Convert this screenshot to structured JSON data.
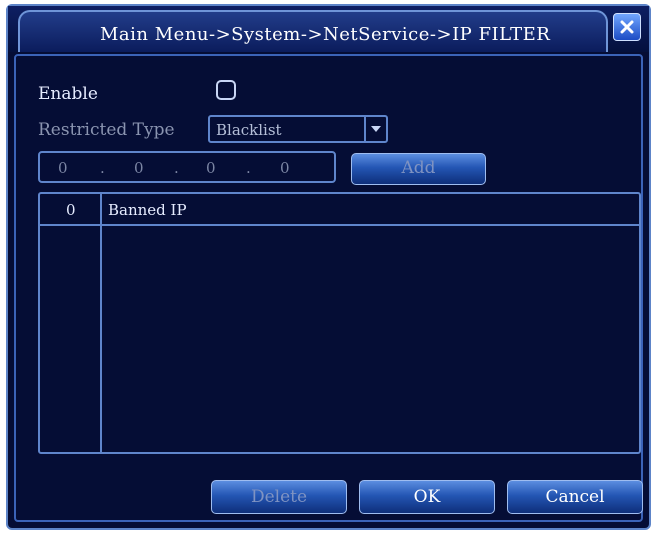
{
  "window": {
    "title": "Main Menu->System->NetService->IP FILTER"
  },
  "form": {
    "enable_label": "Enable",
    "enable_checked": false,
    "restricted_type_label": "Restricted Type",
    "restricted_type_value": "Blacklist",
    "ip_parts": [
      "0",
      "0",
      "0",
      "0"
    ],
    "add_label": "Add"
  },
  "table": {
    "col_index": "0",
    "col_banned_ip": "Banned IP",
    "rows": []
  },
  "footer": {
    "delete_label": "Delete",
    "ok_label": "OK",
    "cancel_label": "Cancel"
  },
  "icons": {
    "close": "close-icon",
    "dropdown": "chevron-down-icon"
  },
  "colors": {
    "background": "#050d35",
    "border": "#5f85cc",
    "text": "#e6ecff",
    "button": "#2456b4"
  }
}
